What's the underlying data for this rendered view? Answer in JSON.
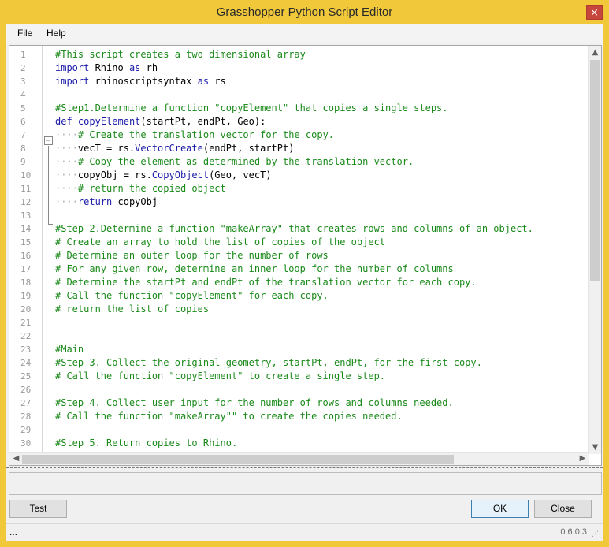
{
  "window": {
    "title": "Grasshopper Python Script Editor",
    "close_glyph": "×"
  },
  "menu": {
    "items": [
      {
        "label": "File"
      },
      {
        "label": "Help"
      }
    ]
  },
  "editor": {
    "line_numbers": [
      "1",
      "2",
      "3",
      "4",
      "5",
      "6",
      "7",
      "8",
      "9",
      "10",
      "11",
      "12",
      "13",
      "14",
      "15",
      "16",
      "17",
      "18",
      "19",
      "20",
      "21",
      "22",
      "23",
      "24",
      "25",
      "26",
      "27",
      "28",
      "29",
      "30"
    ],
    "whitespace_marker": "····",
    "lines": [
      [
        {
          "t": "#This script creates a two dimensional array",
          "c": "cm"
        }
      ],
      [
        {
          "t": "import",
          "c": "kw"
        },
        {
          "t": " Rhino ",
          "c": "id"
        },
        {
          "t": "as",
          "c": "kw"
        },
        {
          "t": " rh",
          "c": "id"
        }
      ],
      [
        {
          "t": "import",
          "c": "kw"
        },
        {
          "t": " rhinoscriptsyntax ",
          "c": "id"
        },
        {
          "t": "as",
          "c": "kw"
        },
        {
          "t": " rs",
          "c": "id"
        }
      ],
      [],
      [
        {
          "t": "#Step1.Determine a function \"copyElement\" that copies a single steps.",
          "c": "cm"
        }
      ],
      [
        {
          "t": "def",
          "c": "kw"
        },
        {
          "t": " ",
          "c": "id"
        },
        {
          "t": "copyElement",
          "c": "fn"
        },
        {
          "t": "(startPt, endPt, Geo):",
          "c": "id"
        }
      ],
      [
        {
          "t": "····",
          "c": "ws"
        },
        {
          "t": "# Create the translation vector for the copy.",
          "c": "cm"
        }
      ],
      [
        {
          "t": "····",
          "c": "ws"
        },
        {
          "t": "vecT = rs.",
          "c": "id"
        },
        {
          "t": "VectorCreate",
          "c": "fn"
        },
        {
          "t": "(endPt, startPt)",
          "c": "id"
        }
      ],
      [
        {
          "t": "····",
          "c": "ws"
        },
        {
          "t": "# Copy the element as determined by the translation vector.",
          "c": "cm"
        }
      ],
      [
        {
          "t": "····",
          "c": "ws"
        },
        {
          "t": "copyObj = rs.",
          "c": "id"
        },
        {
          "t": "CopyObject",
          "c": "fn"
        },
        {
          "t": "(Geo, vecT)",
          "c": "id"
        }
      ],
      [
        {
          "t": "····",
          "c": "ws"
        },
        {
          "t": "# return the copied object",
          "c": "cm"
        }
      ],
      [
        {
          "t": "····",
          "c": "ws"
        },
        {
          "t": "return",
          "c": "kw"
        },
        {
          "t": " copyObj",
          "c": "id"
        }
      ],
      [],
      [
        {
          "t": "#Step 2.Determine a function \"makeArray\" that creates rows and columns of an object.",
          "c": "cm"
        }
      ],
      [
        {
          "t": "# Create an array to hold the list of copies of the object",
          "c": "cm"
        }
      ],
      [
        {
          "t": "# Determine an outer loop for the number of rows",
          "c": "cm"
        }
      ],
      [
        {
          "t": "# For any given row, determine an inner loop for the number of columns",
          "c": "cm"
        }
      ],
      [
        {
          "t": "# Determine the startPt and endPt of the translation vector for each copy.",
          "c": "cm"
        }
      ],
      [
        {
          "t": "# Call the function \"copyElement\" for each copy.",
          "c": "cm"
        }
      ],
      [
        {
          "t": "# return the list of copies",
          "c": "cm"
        }
      ],
      [],
      [],
      [
        {
          "t": "#Main",
          "c": "cm"
        }
      ],
      [
        {
          "t": "#Step 3. Collect the original geometry, startPt, endPt, for the first copy.'",
          "c": "cm"
        }
      ],
      [
        {
          "t": "# Call the function \"copyElement\" to create a single step.",
          "c": "cm"
        }
      ],
      [],
      [
        {
          "t": "#Step 4. Collect user input for the number of rows and columns needed.",
          "c": "cm"
        }
      ],
      [
        {
          "t": "# Call the function \"makeArray\"\" to create the copies needed.",
          "c": "cm"
        }
      ],
      [],
      [
        {
          "t": "#Step 5. Return copies to Rhino.",
          "c": "cm"
        }
      ]
    ]
  },
  "buttons": {
    "test": "Test",
    "ok": "OK",
    "close": "Close"
  },
  "status": {
    "left": "...",
    "version": "0.6.0.3",
    "grip_glyph": "⋰"
  }
}
